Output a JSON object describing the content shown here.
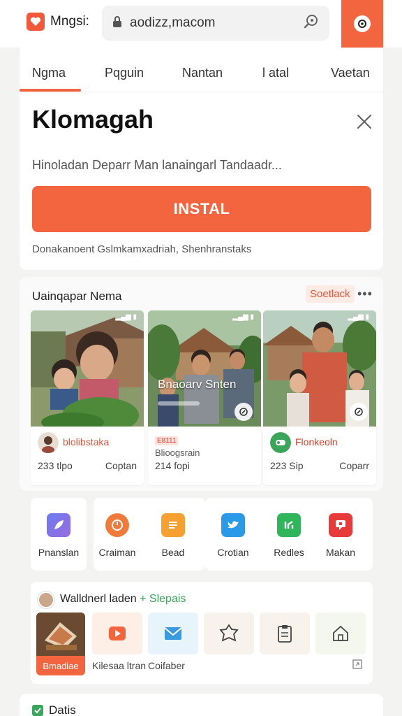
{
  "browser": {
    "brand_name": "Mngsi:",
    "url": "aodizz,macom",
    "brand_color": "#f05a3a",
    "accent_color": "#f2653f"
  },
  "tabs": [
    {
      "label": "Ngma",
      "active": true
    },
    {
      "label": "Pqguin",
      "active": false
    },
    {
      "label": "Nantan",
      "active": false
    },
    {
      "label": "l atal",
      "active": false
    },
    {
      "label": "Vaetan",
      "active": false
    }
  ],
  "promo": {
    "headline": "Klomagah",
    "description": "Hinoladan Deparr Man lanaingarl Tandaadr...",
    "install_label": "INSTAL",
    "subinfo": "Donakanoent Gslmkamxadriah, Shenhranstaks"
  },
  "recommendations": {
    "title": "Uainqapar Nema",
    "chip_label": "Soetlack",
    "more_label": "•••",
    "videos": [
      {
        "name": "blolibstaka",
        "stat": "233 tlpo",
        "action": "Coptan"
      },
      {
        "overlay": "Bnaoarv Snten",
        "tag": "E8111",
        "name": "Blioogsrain",
        "stat": "214 fopi",
        "action": ""
      },
      {
        "name": "Flonkeoln",
        "stat": "223 Sip",
        "action": "Coparr"
      }
    ]
  },
  "apps": [
    {
      "label": "Pnanslan",
      "icon": "feather-icon"
    },
    {
      "label": "Craiman",
      "icon": "target-icon"
    },
    {
      "label": "Bead",
      "icon": "notes-icon"
    },
    {
      "label": "Crotian",
      "icon": "bird-icon"
    },
    {
      "label": "Redles",
      "icon": "chart-icon"
    },
    {
      "label": "Makan",
      "icon": "chat-icon"
    }
  ],
  "follow": {
    "title": "Walldnerl laden",
    "plus_label": "+ Slepais",
    "photo_label": "Bmadiae",
    "captions": [
      "Kilesaa ltran",
      "Coifaber"
    ],
    "tiles": [
      "play-icon",
      "mail-icon",
      "badge-icon",
      "clipboard-icon",
      "home-icon"
    ]
  },
  "bottom": {
    "label": "Datis"
  }
}
